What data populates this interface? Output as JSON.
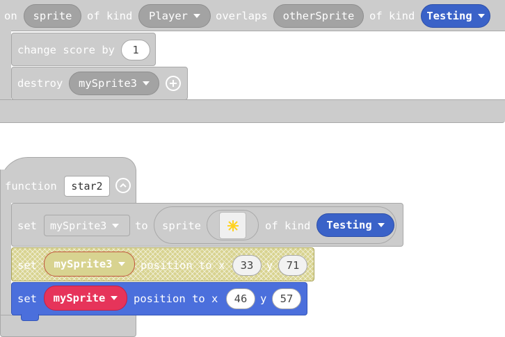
{
  "overlap_event": {
    "on_label": "on",
    "sprite_param": "sprite",
    "of_kind_label_1": "of kind",
    "kind_1": "Player",
    "overlaps_label": "overlaps",
    "other_param": "otherSprite",
    "of_kind_label_2": "of kind",
    "kind_2": "Testing",
    "change_score_label": "change score by",
    "change_score_value": "1",
    "destroy_label": "destroy",
    "destroy_target": "mySprite3"
  },
  "function_block": {
    "function_label": "function",
    "function_name": "star2",
    "set_label_1": "set",
    "set_var_1": "mySprite3",
    "to_label": "to",
    "sprite_label": "sprite",
    "of_kind_label": "of kind",
    "kind": "Testing",
    "set_label_2": "set",
    "set_var_2": "mySprite3",
    "position_label_2": "position to x",
    "x2": "33",
    "y_label_2": "y",
    "y2": "71",
    "set_label_3": "set",
    "set_var_3": "mySprite",
    "position_label_3": "position to x",
    "x3": "46",
    "y_label_3": "y",
    "y3": "57"
  },
  "colors": {
    "block_gray": "#cccccc",
    "kind_blue": "#3a62c8",
    "sprite_red": "#e6345a",
    "motion_blue": "#4b6fdc",
    "disabled_hatch": "#d8d390"
  }
}
